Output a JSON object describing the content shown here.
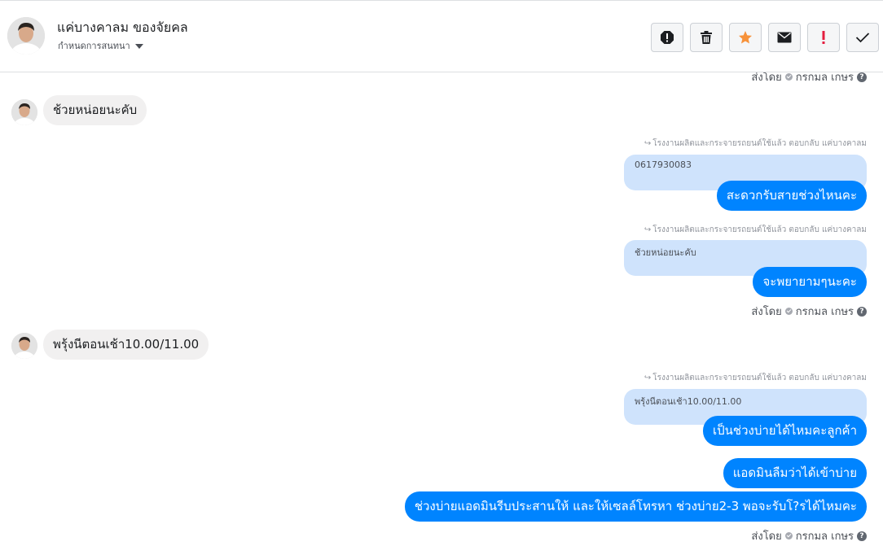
{
  "header": {
    "contact_name": "แค่บางคาลม ของจัยคล",
    "subtitle": "กำหนดการสนทนา",
    "buttons": {
      "spam": "spam-icon",
      "delete": "trash-icon",
      "star": "star-icon",
      "unread": "envelope-icon",
      "important": "exclamation-icon",
      "done": "check-icon"
    },
    "colors": {
      "star": "#f7923a",
      "important": "#e41e3f"
    }
  },
  "messages": {
    "sent_by_top": {
      "label": "ส่งโดย",
      "agent": "กรกมล เกษร"
    },
    "incoming_1": "ช้วยหน่อยนะคับ",
    "reply_meta_1": "โรงงานผลิตและกระจายรถยนต์ใช้แล้ว ตอบกลับ แค่บางคาลม",
    "quote_1": "0617930083",
    "outgoing_1": "สะดวกรับสายช่วงไหนคะ",
    "reply_meta_2": "โรงงานผลิตและกระจายรถยนต์ใช้แล้ว ตอบกลับ แค่บางคาลม",
    "quote_2": "ช้วยหน่อยนะคับ",
    "outgoing_2": "จะพยายามๆนะคะ",
    "sent_by_mid": {
      "label": "ส่งโดย",
      "agent": "กรกมล เกษร"
    },
    "incoming_2": "พรุ้งนีตอนเช้า10.00/11.00",
    "reply_meta_3": "โรงงานผลิตและกระจายรถยนต์ใช้แล้ว ตอบกลับ แค่บางคาลม",
    "quote_3": "พรุ้งนีตอนเช้า10.00/11.00",
    "outgoing_3": "เป็นช่วงบ่ายได้ไหมคะลูกค้า",
    "outgoing_4": "แอดมินลืมว่าได้เข้าบ่าย",
    "outgoing_5": "ช่วงบ่ายแอดมินรีบประสานให้ และให้เซลล์โทรหา ช่วงบ่าย2-3 พอจะรับโ?รได้ไหมคะ",
    "sent_by_bottom": {
      "label": "ส่งโดย",
      "agent": "กรกมล เกษร"
    }
  },
  "colors": {
    "outgoing_bubble": "#0084ff",
    "incoming_bubble": "#f1f0f0",
    "quote_bubble": "#cfe3fc"
  }
}
